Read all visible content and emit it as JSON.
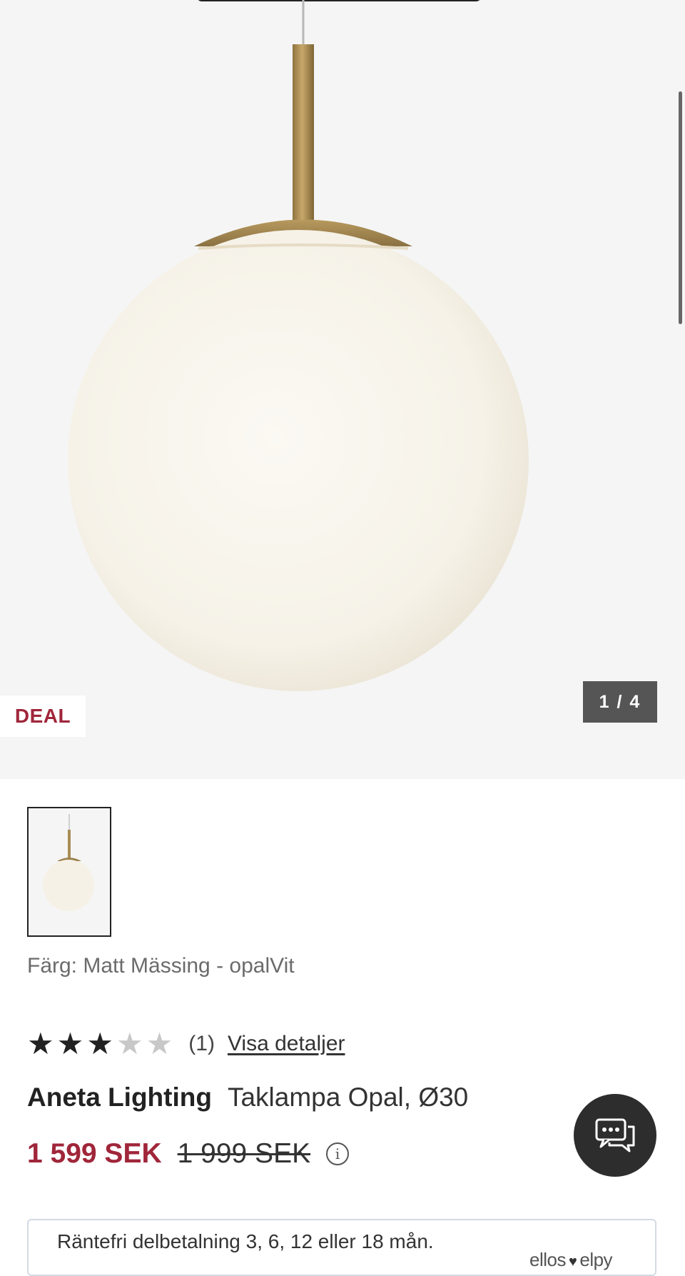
{
  "gallery": {
    "deal_label": "DEAL",
    "counter": "1 / 4",
    "current_image": 1,
    "total_images": 4
  },
  "product": {
    "color_line": "Färg: Matt Mässing - opalVit",
    "rating": 3,
    "rating_max": 5,
    "review_count": "(1)",
    "details_link": "Visa detaljer",
    "brand": "Aneta Lighting",
    "name": "Taklampa Opal, Ø30",
    "price_now": "1 599 SEK",
    "price_old": "1 999 SEK",
    "price_info_icon": "info-icon"
  },
  "finance": {
    "text": "Räntefri delbetalning 3, 6, 12 eller 18 mån.",
    "logo_left": "ellos",
    "logo_right": "elpy"
  },
  "chat": {
    "icon": "chat-bubbles-icon"
  },
  "colors": {
    "accent": "#a0263a",
    "gallery_bg": "#f5f5f5",
    "counter_bg": "#555555",
    "chat_bg": "#2d2d2d"
  }
}
